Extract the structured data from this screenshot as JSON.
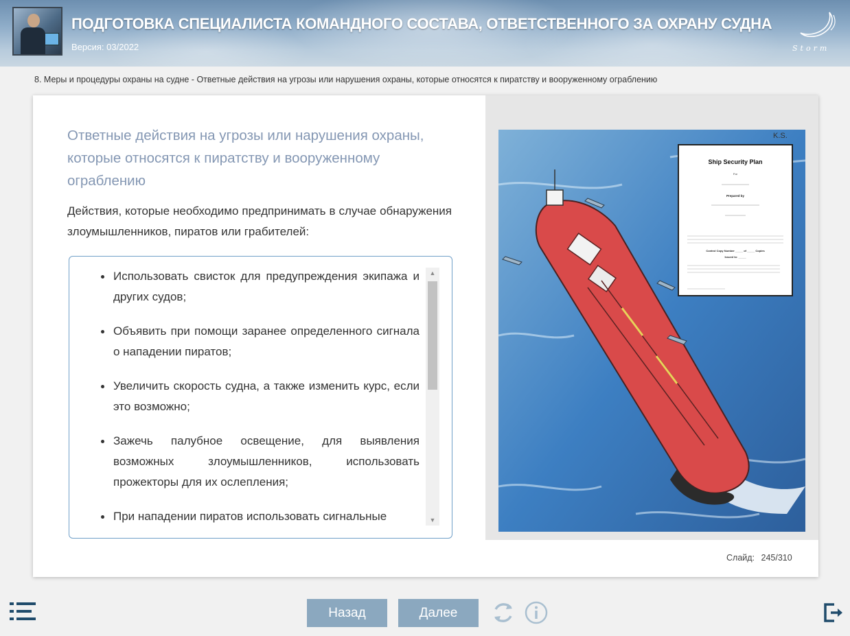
{
  "header": {
    "title": "ПОДГОТОВКА СПЕЦИАЛИСТА КОМАНДНОГО СОСТАВА, ОТВЕТСТВЕННОГО ЗА ОХРАНУ СУДНА",
    "version": "Версия: 03/2022",
    "logo_text": "Storm"
  },
  "breadcrumb": "8. Меры и процедуры охраны на судне - Ответные действия на угрозы или нарушения охраны, которые относятся к пиратству и вооруженному ограблению",
  "slide": {
    "title": "Ответные действия на угрозы или нарушения охраны, которые относятся к пиратству и вооруженному ограблению",
    "intro": "Действия, которые необходимо предпринимать в случае обнаружения злоумышленников, пиратов или грабителей:",
    "bullets": [
      "Использовать свисток для предупреждения экипажа и других судов;",
      "Объявить при помощи заранее определенного сигнала о нападении пиратов;",
      "Увеличить скорость судна, а также изменить курс, если это возможно;",
      "Зажечь палубное освещение, для выявления возможных злоумышленников, использовать прожекторы для их ослепления;",
      "При нападении пиратов использовать сигнальные"
    ],
    "image": {
      "signature": "K.S.",
      "doc_title": "Ship Security Plan",
      "doc_for": "For",
      "doc_prepared": "Prepared by",
      "doc_control": "Control Copy Number _____ of _____ Copies",
      "doc_issued": "Issued to: _____"
    },
    "counter_label": "Слайд:",
    "counter_current": "245",
    "counter_total": "310"
  },
  "controls": {
    "back_label": "Назад",
    "next_label": "Далее"
  },
  "colors": {
    "title_blue": "#8497b3",
    "button_bg": "#8ba8bf",
    "icon_dark": "#1f4b6b",
    "list_border": "#6f9fc8"
  },
  "icons": [
    "menu-icon",
    "reload-icon",
    "info-icon",
    "exit-icon",
    "storm-logo"
  ]
}
